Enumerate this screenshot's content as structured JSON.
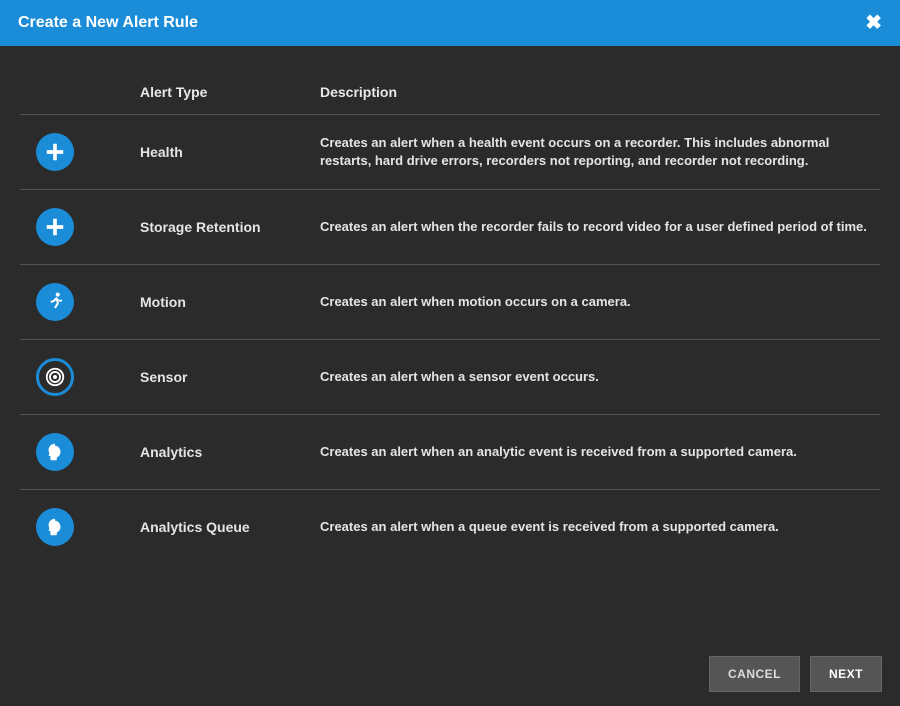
{
  "header": {
    "title": "Create a New Alert Rule",
    "close_label": "Close"
  },
  "columns": {
    "type": "Alert Type",
    "description": "Description"
  },
  "rows": [
    {
      "icon": "plus-icon",
      "name": "Health",
      "description": "Creates an alert when a health event occurs on a recorder. This includes abnormal restarts, hard drive errors, recorders not reporting, and recorder not recording."
    },
    {
      "icon": "plus-icon",
      "name": "Storage Retention",
      "description": "Creates an alert when the recorder fails to record video for a user defined period of time."
    },
    {
      "icon": "running-icon",
      "name": "Motion",
      "description": "Creates an alert when motion occurs on a camera."
    },
    {
      "icon": "target-icon",
      "name": "Sensor",
      "description": "Creates an alert when a sensor event occurs."
    },
    {
      "icon": "head-icon",
      "name": "Analytics",
      "description": "Creates an alert when an analytic event is received from a supported camera."
    },
    {
      "icon": "head-icon",
      "name": "Analytics Queue",
      "description": "Creates an alert when a queue event is received from a supported camera."
    }
  ],
  "footer": {
    "cancel": "CANCEL",
    "next": "NEXT"
  },
  "colors": {
    "accent": "#1a8cd8",
    "panel": "#2b2b2b"
  }
}
